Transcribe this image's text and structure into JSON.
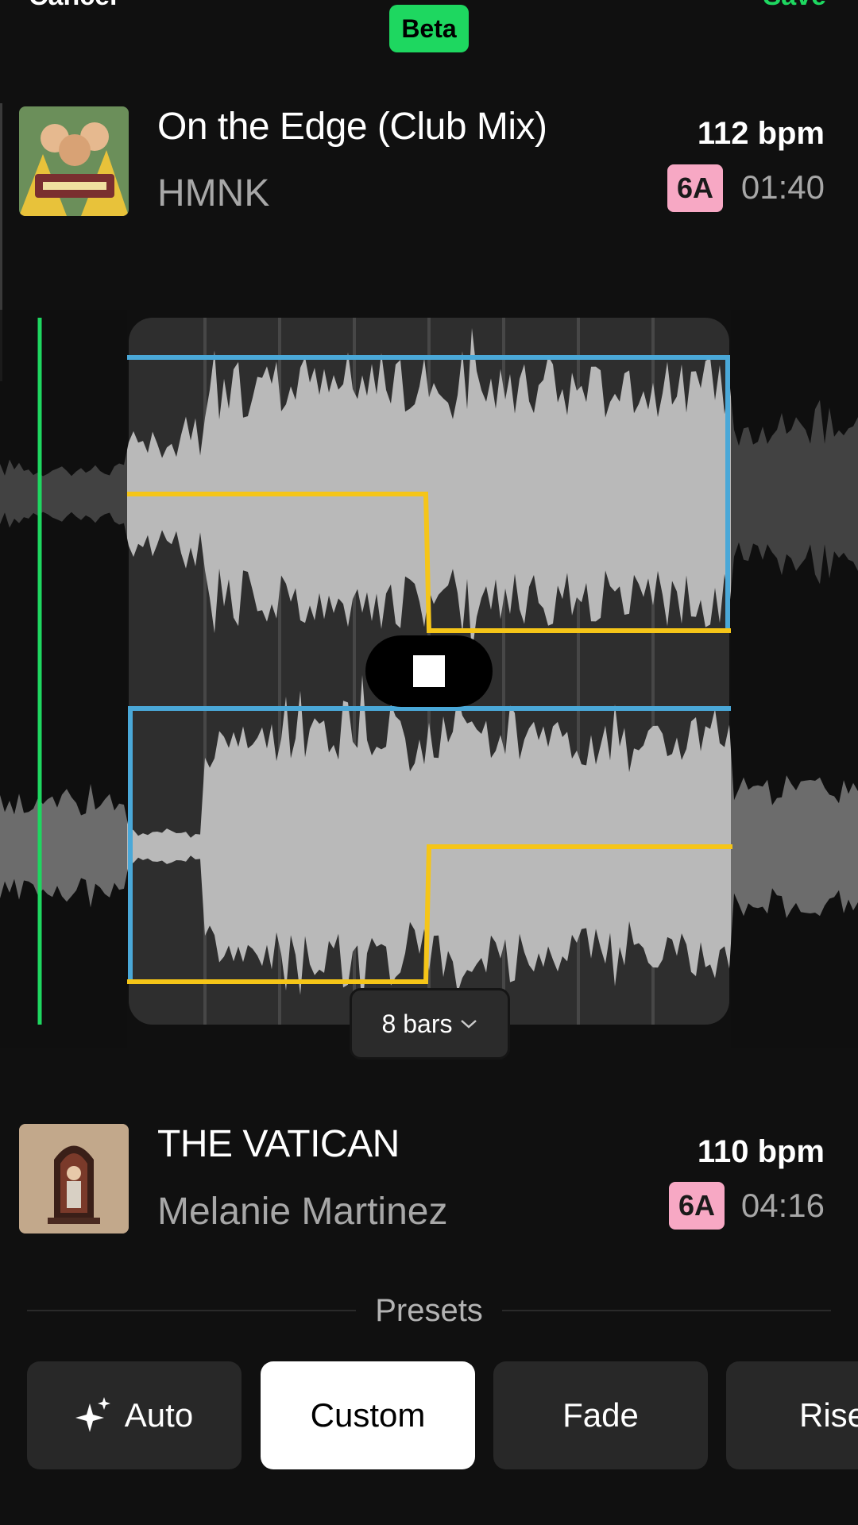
{
  "header": {
    "cancel_label": "Cancel",
    "badge": "Beta",
    "save_label": "Save"
  },
  "track_a": {
    "title": "On the Edge (Club Mix)",
    "artist": "HMNK",
    "bpm": "112 bpm",
    "key": "6A",
    "duration": "01:40"
  },
  "track_b": {
    "title": "THE VATICAN",
    "artist": "Melanie Martinez",
    "bpm": "110 bpm",
    "key": "6A",
    "duration": "04:16"
  },
  "transition": {
    "length_label": "8 bars",
    "length_icon": "chevron-down-icon",
    "play_state_icon": "stop-icon"
  },
  "presets": {
    "heading": "Presets",
    "items": [
      {
        "label": "Auto",
        "icon": "sparkle-icon"
      },
      {
        "label": "Custom",
        "selected": true
      },
      {
        "label": "Fade"
      },
      {
        "label": "Rise"
      }
    ]
  },
  "colors": {
    "accent": "#1ed760",
    "volume_curve": "#4aa8d8",
    "eq_curve": "#f5c518",
    "key_badge": "#f7a8c4"
  }
}
